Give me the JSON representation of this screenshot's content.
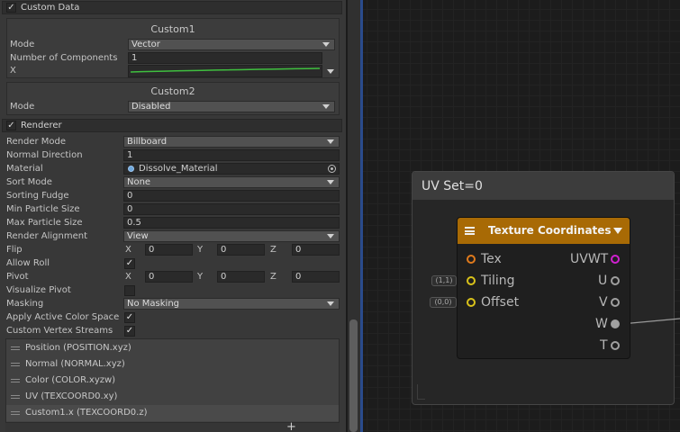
{
  "inspector": {
    "custom_data": {
      "header": "Custom Data",
      "checked_glyph": "✓",
      "custom1": {
        "title": "Custom1",
        "mode_label": "Mode",
        "mode_value": "Vector",
        "components_label": "Number of Components",
        "components_value": "1",
        "x_label": "X"
      },
      "custom2": {
        "title": "Custom2",
        "mode_label": "Mode",
        "mode_value": "Disabled"
      }
    },
    "renderer": {
      "header": "Renderer",
      "checked_glyph": "✓",
      "rows": {
        "render_mode": {
          "label": "Render Mode",
          "value": "Billboard"
        },
        "normal_direction": {
          "label": "Normal Direction",
          "value": "1"
        },
        "material": {
          "label": "Material",
          "value": "Dissolve_Material"
        },
        "sort_mode": {
          "label": "Sort Mode",
          "value": "None"
        },
        "sorting_fudge": {
          "label": "Sorting Fudge",
          "value": "0"
        },
        "min_particle_size": {
          "label": "Min Particle Size",
          "value": "0"
        },
        "max_particle_size": {
          "label": "Max Particle Size",
          "value": "0.5"
        },
        "render_alignment": {
          "label": "Render Alignment",
          "value": "View"
        },
        "flip": {
          "label": "Flip",
          "x_label": "X",
          "x": "0",
          "y_label": "Y",
          "y": "0",
          "z_label": "Z",
          "z": "0"
        },
        "allow_roll": {
          "label": "Allow Roll",
          "checked": true
        },
        "pivot": {
          "label": "Pivot",
          "x_label": "X",
          "x": "0",
          "y_label": "Y",
          "y": "0",
          "z_label": "Z",
          "z": "0"
        },
        "visualize_pivot": {
          "label": "Visualize Pivot",
          "checked": false
        },
        "masking": {
          "label": "Masking",
          "value": "No Masking"
        },
        "apply_active_color_space": {
          "label": "Apply Active Color Space",
          "checked": true
        },
        "custom_vertex_streams": {
          "label": "Custom Vertex Streams",
          "checked": true
        }
      },
      "streams": [
        "Position (POSITION.xyz)",
        "Normal (NORMAL.xyz)",
        "Color (COLOR.xyzw)",
        "UV (TEXCOORD0.xy)",
        "Custom1.x (TEXCOORD0.z)"
      ],
      "add_glyph": "+"
    }
  },
  "graph": {
    "group_title": "UV Set=0",
    "tiling_tag": "(1,1)",
    "offset_tag": "(0,0)",
    "node": {
      "title": "Texture Coordinates",
      "inputs": [
        "Tex",
        "Tiling",
        "Offset"
      ],
      "outputs": [
        "UVWT",
        "U",
        "V",
        "W",
        "T"
      ]
    }
  },
  "colors": {
    "node_header": "#a86a05",
    "port_orange": "#e07a1c",
    "port_yellow": "#d9c21a",
    "port_magenta": "#d020d0",
    "port_gray": "#a0a0a0",
    "curve_green": "#3fbf3f",
    "link_line": "#9a9a9a"
  }
}
